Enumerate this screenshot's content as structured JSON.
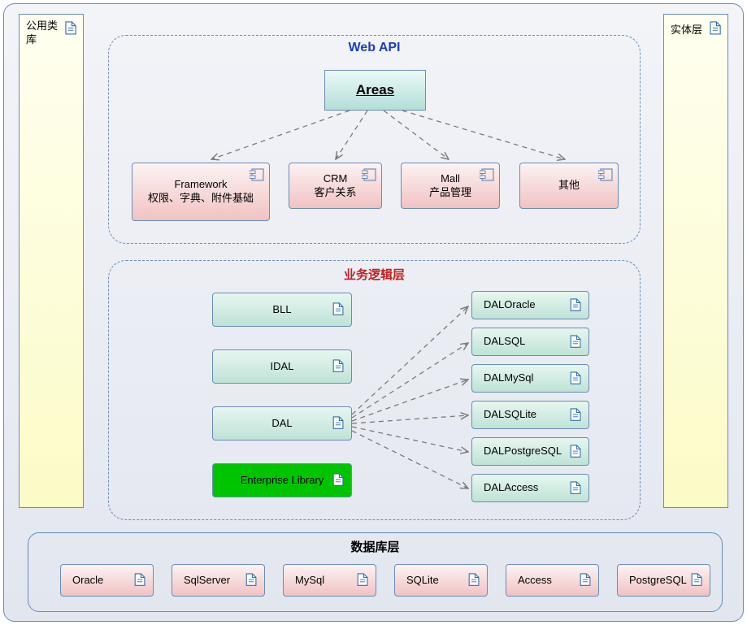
{
  "outer_frame": {},
  "yellow_left": {
    "label": "公用类库"
  },
  "yellow_right": {
    "label": "实体层"
  },
  "group_webapi": {
    "title": "Web API"
  },
  "areas_box": {
    "label": "Areas"
  },
  "comp_framework": {
    "line1": "Framework",
    "line2": "权限、字典、附件基础"
  },
  "comp_crm": {
    "line1": "CRM",
    "line2": "客户关系"
  },
  "comp_mall": {
    "line1": "Mall",
    "line2": "产品管理"
  },
  "comp_other": {
    "line1": "其他",
    "line2": ""
  },
  "group_bll": {
    "title": "业务逻辑层"
  },
  "box_bll": {
    "label": "BLL"
  },
  "box_idal": {
    "label": "IDAL"
  },
  "box_dal": {
    "label": "DAL"
  },
  "box_elib": {
    "label": "Enterprise Library"
  },
  "box_daloracle": {
    "label": "DALOracle"
  },
  "box_dalsql": {
    "label": "DALSQL"
  },
  "box_dalmysql": {
    "label": "DALMySql"
  },
  "box_dalsqlite": {
    "label": "DALSQLite"
  },
  "box_dalpostgres": {
    "label": "DALPostgreSQL"
  },
  "box_dalaccess": {
    "label": "DALAccess"
  },
  "group_db": {
    "title": "数据库层"
  },
  "db_oracle": {
    "label": "Oracle"
  },
  "db_sqlserver": {
    "label": "SqlServer"
  },
  "db_mysql": {
    "label": "MySql"
  },
  "db_sqlite": {
    "label": "SQLite"
  },
  "db_access": {
    "label": "Access"
  },
  "db_postgres": {
    "label": "PostgreSQL"
  },
  "colors": {
    "title_blue": "#1B3FBF",
    "title_red": "#C11F1F"
  }
}
